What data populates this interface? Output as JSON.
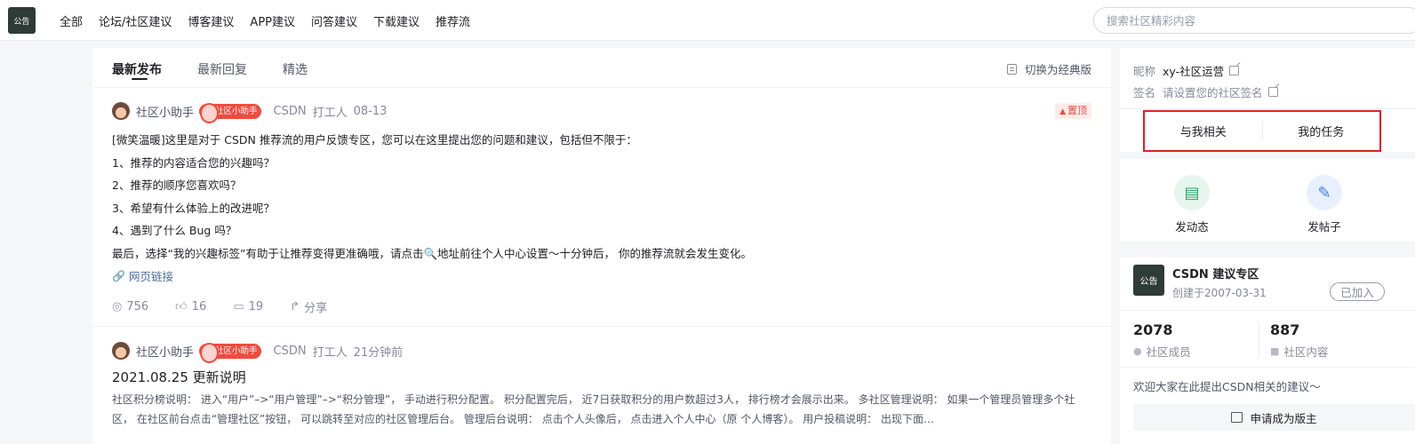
{
  "topbar": {
    "logo_text": "公告",
    "nav": [
      "全部",
      "论坛/社区建议",
      "博客建议",
      "APP建议",
      "问答建议",
      "下载建议",
      "推荐流"
    ],
    "search_placeholder": "搜索社区精彩内容"
  },
  "feed": {
    "tabs": [
      "最新发布",
      "最新回复",
      "精选"
    ],
    "active_tab": "最新发布",
    "switch_label": "切换为经典版"
  },
  "posts": [
    {
      "author": "社区小助手",
      "role": "社区小助手",
      "org": "CSDN",
      "rank": "打工人",
      "time": "08-13",
      "pin_label": "置顶",
      "lines": [
        "[微笑温暖]这里是对于 CSDN 推荐流的用户反馈专区，您可以在这里提出您的问题和建议，包括但不限于：",
        "1、推荐的内容适合您的兴趣吗？",
        "2、推荐的顺序您喜欢吗？",
        "3、希望有什么体验上的改进呢？",
        "4、遇到了什么 Bug 吗？",
        "最后，选择“我的兴趣标签”有助于让推荐变得更准确哦，请点击🔍地址前往个人中心设置～十分钟后， 你的推荐流就会发生变化。"
      ],
      "link_text": "网页链接",
      "views": "756",
      "likes": "16",
      "comments": "19",
      "share_label": "分享"
    },
    {
      "author": "社区小助手",
      "role": "社区小助手",
      "org": "CSDN",
      "rank": "打工人",
      "time": "21分钟前",
      "title": "2021.08.25 更新说明",
      "excerpt": "社区积分榜说明： 进入“用户”–>“用户管理”–>“积分管理”， 手动进行积分配置。 积分配置完后， 近7日获取积分的用户数超过3人， 排行榜才会展示出来。 多社区管理说明： 如果一个管理员管理多个社区， 在社区前台点击“管理社区”按钮， 可以跳转至对应的社区管理后台。 管理后台说明： 点击个人头像后， 点击进入个人中心（原 个人博客）。 用户投稿说明： 出现下面…"
    }
  ],
  "profile": {
    "nickname_label": "昵称",
    "nickname": "xy-社区运营",
    "signature_label": "签名",
    "signature_placeholder": "请设置您的社区签名",
    "related_btn": "与我相关",
    "tasks_btn": "我的任务"
  },
  "actions": {
    "dynamic_label": "发动态",
    "post_label": "发帖子",
    "dynamic_color": "#2ea36b",
    "post_color": "#3b7de9"
  },
  "community": {
    "logo_text": "公告",
    "name": "CSDN 建议专区",
    "created": "创建于2007-03-31",
    "joined_label": "已加入",
    "members": "2078",
    "members_label": "社区成员",
    "contents": "887",
    "contents_label": "社区内容",
    "welcome": "欢迎大家在此提出CSDN相关的建议～",
    "apply_label": "申请成为版主"
  }
}
